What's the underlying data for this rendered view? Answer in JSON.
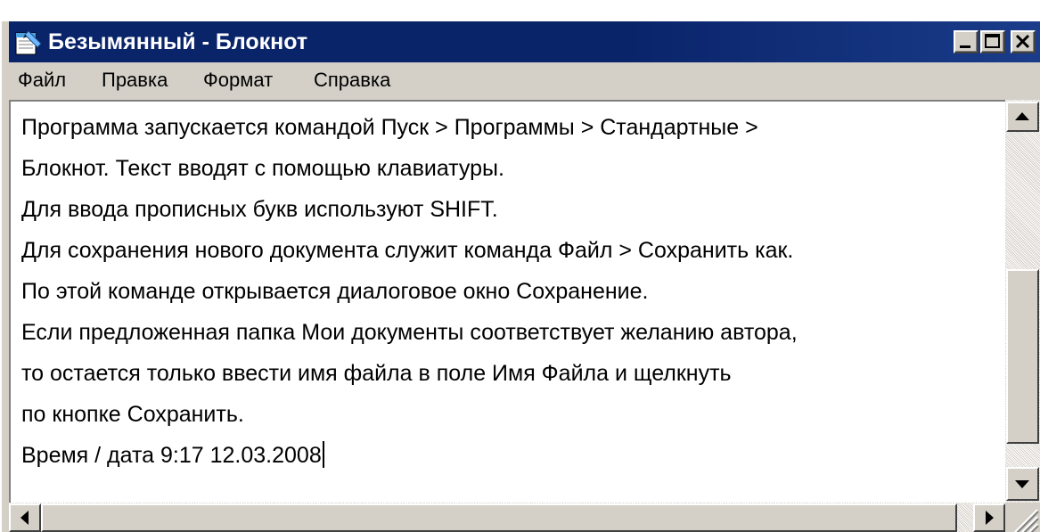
{
  "window": {
    "title": "Безымянный - Блокнот",
    "title_bar_color": "#0a246a",
    "icons": {
      "app": "notepad-icon",
      "minimize": "minimize-icon",
      "maximize": "maximize-icon",
      "close": "close-icon"
    }
  },
  "menu": {
    "items": [
      {
        "label": "Файл"
      },
      {
        "label": "Правка"
      },
      {
        "label": "Формат"
      },
      {
        "label": "Справка"
      }
    ]
  },
  "editor": {
    "lines": [
      "Программа запускается командой Пуск > Программы > Стандартные >",
      "Блокнот. Текст вводят с помощью клавиатуры.",
      "Для ввода прописных букв используют SHIFT.",
      "Для сохранения нового документа служит команда Файл > Сохранить как.",
      "По этой команде открывается диалоговое окно Сохранение.",
      "Если предложенная папка Мои документы соответствует желанию автора,",
      "то остается только ввести имя файла в поле Имя Файла и щелкнуть",
      "по кнопке Сохранить.",
      "Время / дата 9:17 12.03.2008"
    ]
  },
  "scrollbars": {
    "icons": {
      "up": "scroll-up-arrow-icon",
      "down": "scroll-down-arrow-icon",
      "left": "scroll-left-arrow-icon",
      "right": "scroll-right-arrow-icon",
      "grip": "resize-grip-icon"
    }
  }
}
